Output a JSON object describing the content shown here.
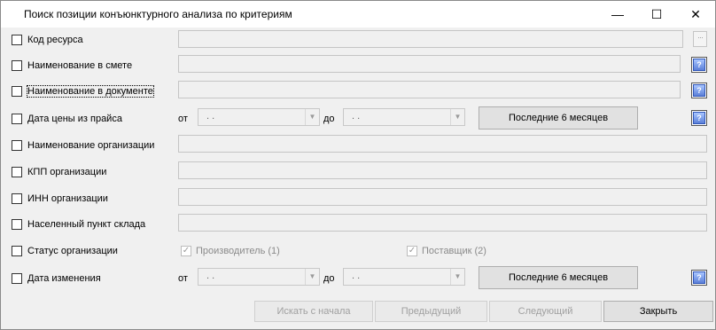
{
  "window": {
    "title": "Поиск позиции конъюнктурного анализа по критериям",
    "minimize": "—",
    "maximize": "☐",
    "close": "✕"
  },
  "criteria": [
    {
      "label": "Код ресурса"
    },
    {
      "label": "Наименование в смете"
    },
    {
      "label": "Наименование в документе"
    },
    {
      "label": "Дата цены из прайса"
    },
    {
      "label": "Наименование организации"
    },
    {
      "label": "КПП организации"
    },
    {
      "label": "ИНН организации"
    },
    {
      "label": "Населенный пункт склада"
    },
    {
      "label": "Статус организации"
    },
    {
      "label": "Дата изменения"
    }
  ],
  "date_price": {
    "from_label": "от",
    "to_label": "до",
    "from_value": " .  .",
    "to_value": " .  .",
    "last6_label": "Последние 6 месяцев"
  },
  "date_change": {
    "from_label": "от",
    "to_label": "до",
    "from_value": " .  .",
    "to_value": " .  .",
    "last6_label": "Последние 6 месяцев"
  },
  "status": {
    "producer": "Производитель (1)",
    "supplier": "Поставщик (2)"
  },
  "help_label": "?",
  "ellipsis_label": "···",
  "footer": {
    "search_from_start": "Искать с начала",
    "previous": "Предыдущий",
    "next": "Следующий",
    "close": "Закрыть"
  }
}
